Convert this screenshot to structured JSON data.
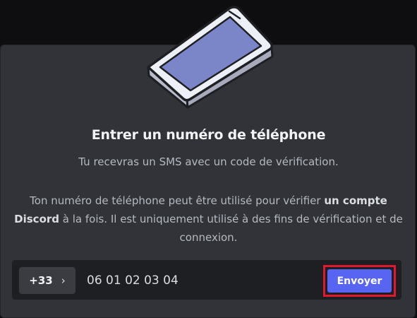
{
  "modal": {
    "title": "Entrer un numéro de téléphone",
    "subtitle": "Tu recevras un SMS avec un code de vérification.",
    "description_part1": "Ton numéro de téléphone peut être utilisé pour vérifier ",
    "description_bold": "un compte Discord",
    "description_part2": " à la fois. Il est uniquement utilisé à des fins de vérification et de connexion."
  },
  "phone_input": {
    "country_code": "+33",
    "chevron_icon": "chevron-right-icon",
    "value": "06 01 02 03 04",
    "send_label": "Envoyer"
  },
  "colors": {
    "accent": "#5865f2",
    "highlight": "#e0192e",
    "modal_bg": "#313338",
    "input_bg": "#1e1f22"
  },
  "illustration_icon": "phone-illustration-icon"
}
